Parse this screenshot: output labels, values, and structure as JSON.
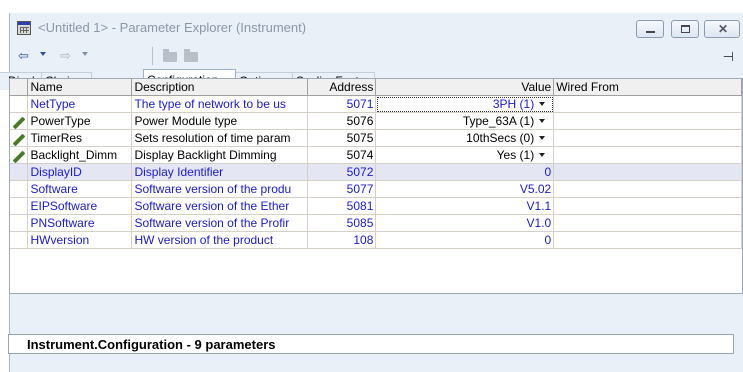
{
  "window": {
    "title": "<Untitled 1> - Parameter Explorer (Instrument)",
    "minimize_label": "",
    "close_label": "✕"
  },
  "toolbar": {
    "back_glyph": "⇦",
    "forward_glyph": "⇨",
    "pin_glyph": "⊣"
  },
  "tabs": [
    "Display",
    "Chains",
    "Configuration",
    "Options",
    "ScalingFactor"
  ],
  "active_tab": "Configuration",
  "table": {
    "headers": {
      "name": "Name",
      "description": "Description",
      "address": "Address",
      "value": "Value",
      "wired_from": "Wired From"
    },
    "rows": [
      {
        "name": "NetType",
        "description": "The type of network to be us",
        "address": "5071",
        "value": "3PH (1)",
        "dropdown": true,
        "editable": false
      },
      {
        "name": "PowerType",
        "description": "Power Module type",
        "address": "5076",
        "value": "Type_63A (1)",
        "dropdown": true,
        "editable": true
      },
      {
        "name": "TimerRes",
        "description": "Sets resolution of time param",
        "address": "5075",
        "value": "10thSecs (0)",
        "dropdown": true,
        "editable": true
      },
      {
        "name": "Backlight_Dimm",
        "description": "Display Backlight Dimming",
        "address": "5074",
        "value": "Yes (1)",
        "dropdown": true,
        "editable": true
      },
      {
        "name": "DisplayID",
        "description": "Display Identifier",
        "address": "5072",
        "value": "0",
        "dropdown": false,
        "editable": false
      },
      {
        "name": "Software",
        "description": "Software version of the produ",
        "address": "5077",
        "value": "V5.02",
        "dropdown": false,
        "editable": false
      },
      {
        "name": "EIPSoftware",
        "description": "Software version of the Ether",
        "address": "5081",
        "value": "V1.1",
        "dropdown": false,
        "editable": false
      },
      {
        "name": "PNSoftware",
        "description": "Software version of the Profir",
        "address": "5085",
        "value": "V1.0",
        "dropdown": false,
        "editable": false
      },
      {
        "name": "HWversion",
        "description": "HW version of the product",
        "address": "108",
        "value": "0",
        "dropdown": false,
        "editable": false
      }
    ]
  },
  "status": {
    "text": "Instrument.Configuration  -  9 parameters"
  },
  "colors": {
    "readonly_text": "#1a1ad0",
    "selected_row": "#e4e6f4",
    "edit_icon": "#4a7a2a"
  }
}
